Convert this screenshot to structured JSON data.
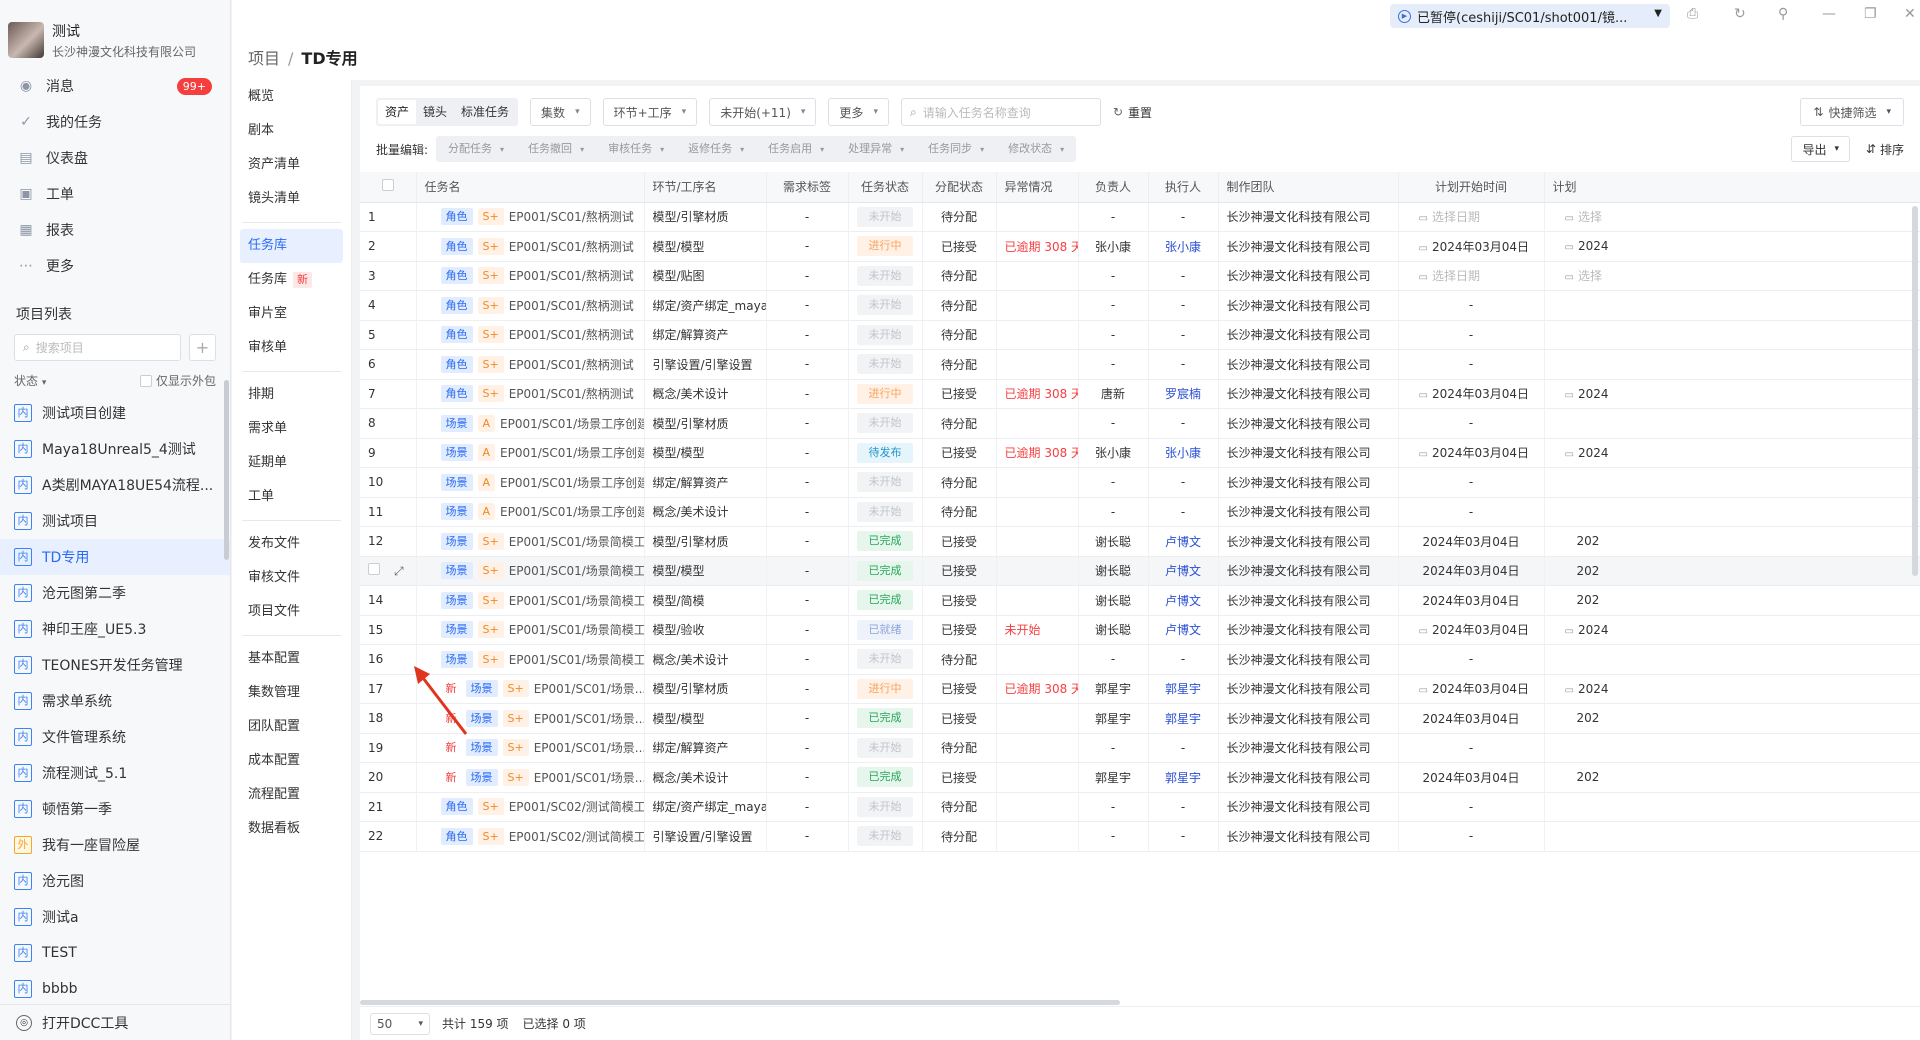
{
  "user": {
    "name": "测试",
    "company": "长沙神漫文化科技有限公司"
  },
  "nav": [
    {
      "label": "消息",
      "icon": "message-icon",
      "badge": "99+"
    },
    {
      "label": "我的任务",
      "icon": "check-icon"
    },
    {
      "label": "仪表盘",
      "icon": "dashboard-icon"
    },
    {
      "label": "工单",
      "icon": "ticket-icon"
    },
    {
      "label": "报表",
      "icon": "report-icon"
    },
    {
      "label": "更多",
      "icon": "more-icon"
    }
  ],
  "projects_section": {
    "title": "项目列表",
    "search_placeholder": "搜索项目",
    "add": "+",
    "status_label": "状态",
    "outsource_only": "仅显示外包"
  },
  "projects": [
    {
      "tag": "内",
      "name": "测试项目创建"
    },
    {
      "tag": "内",
      "name": "Maya18Unreal5_4测试"
    },
    {
      "tag": "内",
      "name": "A类剧MAYA18UE54流程..."
    },
    {
      "tag": "内",
      "name": "测试项目"
    },
    {
      "tag": "内",
      "name": "TD专用"
    },
    {
      "tag": "内",
      "name": "沧元图第二季"
    },
    {
      "tag": "内",
      "name": "神印王座_UE5.3"
    },
    {
      "tag": "内",
      "name": "TEONES开发任务管理"
    },
    {
      "tag": "内",
      "name": "需求单系统"
    },
    {
      "tag": "内",
      "name": "文件管理系统"
    },
    {
      "tag": "内",
      "name": "流程测试_5.1"
    },
    {
      "tag": "内",
      "name": "顿悟第一季"
    },
    {
      "tag": "外",
      "name": "我有一座冒险屋"
    },
    {
      "tag": "内",
      "name": "沧元图"
    },
    {
      "tag": "内",
      "name": "测试a"
    },
    {
      "tag": "内",
      "name": "TEST"
    },
    {
      "tag": "内",
      "name": "bbbb"
    }
  ],
  "bottom_tool": "打开DCC工具",
  "breadcrumb": {
    "parent": "项目",
    "sep": "/",
    "current": "TD专用"
  },
  "pause_pill": "已暂停(ceshiji/SC01/shot001/镜...",
  "subnav": [
    "概览",
    "剧本",
    "资产清单",
    "镜头清单",
    "任务库",
    "任务库",
    "审片室",
    "审核单",
    "排期",
    "需求单",
    "延期单",
    "工单",
    "发布文件",
    "审核文件",
    "项目文件",
    "基本配置",
    "集数管理",
    "团队配置",
    "成本配置",
    "流程配置",
    "数据看板"
  ],
  "subnav_new": "新",
  "toolbar": {
    "segments": [
      "资产",
      "镜头",
      "标准任务"
    ],
    "dropdowns": [
      "集数",
      "环节+工序",
      "未开始(+11)",
      "更多"
    ],
    "search_placeholder": "请输入任务名称查询",
    "reset": "重置",
    "quick_filter": "快捷筛选"
  },
  "batch": {
    "label": "批量编辑:",
    "actions": [
      "分配任务",
      "任务撤回",
      "审核任务",
      "返修任务",
      "任务启用",
      "处理异常",
      "任务同步",
      "修改状态"
    ],
    "export": "导出",
    "sort": "排序"
  },
  "columns": [
    "任务名",
    "环节/工序名",
    "需求标签",
    "任务状态",
    "分配状态",
    "异常情况",
    "负责人",
    "执行人",
    "制作团队",
    "计划开始时间",
    "计划"
  ],
  "rows": [
    {
      "no": "1",
      "new": "",
      "type": "角色",
      "lvl": "S+",
      "name": "EP001/SC01/熬柄测试",
      "star": false,
      "stage": "模型/引擎材质",
      "tag": "-",
      "status": "未开始",
      "st": "pend",
      "assign": "待分配",
      "abn": "",
      "owner": "-",
      "exec": "-",
      "team": "长沙神漫文化科技有限公司",
      "start": "选择日期",
      "startph": true,
      "end": "选择"
    },
    {
      "no": "2",
      "new": "",
      "type": "角色",
      "lvl": "S+",
      "name": "EP001/SC01/熬柄测试",
      "star": false,
      "stage": "模型/模型",
      "tag": "-",
      "status": "进行中",
      "st": "prog",
      "assign": "已接受",
      "abn": "已逾期 308 天",
      "owner": "张小康",
      "exec": "张小康",
      "team": "长沙神漫文化科技有限公司",
      "start": "2024年03月04日",
      "startcal": true,
      "end": "2024"
    },
    {
      "no": "3",
      "new": "",
      "type": "角色",
      "lvl": "S+",
      "name": "EP001/SC01/熬柄测试",
      "star": false,
      "stage": "模型/贴图",
      "tag": "-",
      "status": "未开始",
      "st": "pend",
      "assign": "待分配",
      "abn": "",
      "owner": "-",
      "exec": "-",
      "team": "长沙神漫文化科技有限公司",
      "start": "选择日期",
      "startph": true,
      "end": "选择"
    },
    {
      "no": "4",
      "new": "",
      "type": "角色",
      "lvl": "S+",
      "name": "EP001/SC01/熬柄测试",
      "star": false,
      "stage": "绑定/资产绑定_maya",
      "tag": "-",
      "status": "未开始",
      "st": "pend",
      "assign": "待分配",
      "abn": "",
      "owner": "-",
      "exec": "-",
      "team": "长沙神漫文化科技有限公司",
      "start": "-",
      "end": ""
    },
    {
      "no": "5",
      "new": "",
      "type": "角色",
      "lvl": "S+",
      "name": "EP001/SC01/熬柄测试",
      "star": false,
      "stage": "绑定/解算资产",
      "tag": "-",
      "status": "未开始",
      "st": "pend",
      "assign": "待分配",
      "abn": "",
      "owner": "-",
      "exec": "-",
      "team": "长沙神漫文化科技有限公司",
      "start": "-",
      "end": ""
    },
    {
      "no": "6",
      "new": "",
      "type": "角色",
      "lvl": "S+",
      "name": "EP001/SC01/熬柄测试",
      "star": false,
      "stage": "引擎设置/引擎设置",
      "tag": "-",
      "status": "未开始",
      "st": "pend",
      "assign": "待分配",
      "abn": "",
      "owner": "-",
      "exec": "-",
      "team": "长沙神漫文化科技有限公司",
      "start": "-",
      "end": ""
    },
    {
      "no": "7",
      "new": "",
      "type": "角色",
      "lvl": "S+",
      "name": "EP001/SC01/熬柄测试",
      "star": false,
      "stage": "概念/美术设计",
      "tag": "-",
      "status": "进行中",
      "st": "prog",
      "assign": "已接受",
      "abn": "已逾期 308 天",
      "owner": "唐新",
      "exec": "罗宸楠",
      "team": "长沙神漫文化科技有限公司",
      "start": "2024年03月04日",
      "startcal": true,
      "end": "2024"
    },
    {
      "no": "8",
      "new": "",
      "type": "场景",
      "lvl": "A",
      "name": "EP001/SC01/场景工序创建...",
      "star": false,
      "stage": "模型/引擎材质",
      "tag": "-",
      "status": "未开始",
      "st": "pend",
      "assign": "待分配",
      "abn": "",
      "owner": "-",
      "exec": "-",
      "team": "长沙神漫文化科技有限公司",
      "start": "-",
      "end": ""
    },
    {
      "no": "9",
      "new": "",
      "type": "场景",
      "lvl": "A",
      "name": "EP001/SC01/场景工序创建...",
      "star": false,
      "stage": "模型/模型",
      "tag": "-",
      "status": "待发布",
      "st": "pub",
      "assign": "已接受",
      "abn": "已逾期 308 天",
      "owner": "张小康",
      "exec": "张小康",
      "team": "长沙神漫文化科技有限公司",
      "start": "2024年03月04日",
      "startcal": true,
      "end": "2024"
    },
    {
      "no": "10",
      "new": "",
      "type": "场景",
      "lvl": "A",
      "name": "EP001/SC01/场景工序创建...",
      "star": false,
      "stage": "绑定/解算资产",
      "tag": "-",
      "status": "未开始",
      "st": "pend",
      "assign": "待分配",
      "abn": "",
      "owner": "-",
      "exec": "-",
      "team": "长沙神漫文化科技有限公司",
      "start": "-",
      "end": ""
    },
    {
      "no": "11",
      "new": "",
      "type": "场景",
      "lvl": "A",
      "name": "EP001/SC01/场景工序创建...",
      "star": false,
      "stage": "概念/美术设计",
      "tag": "-",
      "status": "未开始",
      "st": "pend",
      "assign": "待分配",
      "abn": "",
      "owner": "-",
      "exec": "-",
      "team": "长沙神漫文化科技有限公司",
      "start": "-",
      "end": ""
    },
    {
      "no": "12",
      "new": "",
      "type": "场景",
      "lvl": "S+",
      "name": "EP001/SC01/场景简模工序...",
      "star": false,
      "stage": "模型/引擎材质",
      "tag": "-",
      "status": "已完成",
      "st": "done",
      "assign": "已接受",
      "abn": "",
      "owner": "谢长聪",
      "exec": "卢博文",
      "team": "长沙神漫文化科技有限公司",
      "start": "2024年03月04日",
      "end": "202"
    },
    {
      "no": "",
      "hover": true,
      "new": "",
      "type": "场景",
      "lvl": "S+",
      "name": "EP001/SC01/场景简模工序...",
      "star": false,
      "stage": "模型/模型",
      "tag": "-",
      "status": "已完成",
      "st": "done",
      "assign": "已接受",
      "abn": "",
      "owner": "谢长聪",
      "exec": "卢博文",
      "team": "长沙神漫文化科技有限公司",
      "start": "2024年03月04日",
      "end": "202"
    },
    {
      "no": "14",
      "new": "",
      "type": "场景",
      "lvl": "S+",
      "name": "EP001/SC01/场景简模工序...",
      "star": false,
      "stage": "模型/简模",
      "tag": "-",
      "status": "已完成",
      "st": "done",
      "assign": "已接受",
      "abn": "",
      "owner": "谢长聪",
      "exec": "卢博文",
      "team": "长沙神漫文化科技有限公司",
      "start": "2024年03月04日",
      "end": "202"
    },
    {
      "no": "15",
      "new": "",
      "type": "场景",
      "lvl": "S+",
      "name": "EP001/SC01/场景简模工序...",
      "star": false,
      "stage": "模型/验收",
      "tag": "-",
      "status": "已就绪",
      "st": "ready",
      "assign": "已接受",
      "abn": "未开始",
      "owner": "谢长聪",
      "exec": "卢博文",
      "team": "长沙神漫文化科技有限公司",
      "start": "2024年03月04日",
      "startcal": true,
      "end": "2024"
    },
    {
      "no": "16",
      "new": "",
      "type": "场景",
      "lvl": "S+",
      "name": "EP001/SC01/场景简模工序...",
      "star": false,
      "stage": "概念/美术设计",
      "tag": "-",
      "status": "未开始",
      "st": "pend",
      "assign": "待分配",
      "abn": "",
      "owner": "-",
      "exec": "-",
      "team": "长沙神漫文化科技有限公司",
      "start": "-",
      "end": ""
    },
    {
      "no": "17",
      "new": "新",
      "type": "场景",
      "lvl": "S+",
      "name": "EP001/SC01/场景...",
      "star": true,
      "stage": "模型/引擎材质",
      "tag": "-",
      "status": "进行中",
      "st": "prog",
      "assign": "已接受",
      "abn": "已逾期 308 天",
      "owner": "郭星宇",
      "exec": "郭星宇",
      "team": "长沙神漫文化科技有限公司",
      "start": "2024年03月04日",
      "startcal": true,
      "end": "2024"
    },
    {
      "no": "18",
      "new": "新",
      "type": "场景",
      "lvl": "S+",
      "name": "EP001/SC01/场景...",
      "star": true,
      "stage": "模型/模型",
      "tag": "-",
      "status": "已完成",
      "st": "done",
      "assign": "已接受",
      "abn": "",
      "owner": "郭星宇",
      "exec": "郭星宇",
      "team": "长沙神漫文化科技有限公司",
      "start": "2024年03月04日",
      "end": "202"
    },
    {
      "no": "19",
      "new": "新",
      "type": "场景",
      "lvl": "S+",
      "name": "EP001/SC01/场景...",
      "star": true,
      "stage": "绑定/解算资产",
      "tag": "-",
      "status": "未开始",
      "st": "pend",
      "assign": "待分配",
      "abn": "",
      "owner": "-",
      "exec": "-",
      "team": "长沙神漫文化科技有限公司",
      "start": "-",
      "end": ""
    },
    {
      "no": "20",
      "new": "新",
      "type": "场景",
      "lvl": "S+",
      "name": "EP001/SC01/场景...",
      "star": true,
      "stage": "概念/美术设计",
      "tag": "-",
      "status": "已完成",
      "st": "done",
      "assign": "已接受",
      "abn": "",
      "owner": "郭星宇",
      "exec": "郭星宇",
      "team": "长沙神漫文化科技有限公司",
      "start": "2024年03月04日",
      "end": "202"
    },
    {
      "no": "21",
      "new": "",
      "type": "角色",
      "lvl": "S+",
      "name": "EP001/SC02/测试简模工序A",
      "star": false,
      "stage": "绑定/资产绑定_maya",
      "tag": "-",
      "status": "未开始",
      "st": "pend",
      "assign": "待分配",
      "abn": "",
      "owner": "-",
      "exec": "-",
      "team": "长沙神漫文化科技有限公司",
      "start": "-",
      "end": ""
    },
    {
      "no": "22",
      "new": "",
      "type": "角色",
      "lvl": "S+",
      "name": "EP001/SC02/测试简模工序A",
      "star": false,
      "stage": "引擎设置/引擎设置",
      "tag": "-",
      "status": "未开始",
      "st": "pend",
      "assign": "待分配",
      "abn": "",
      "owner": "-",
      "exec": "-",
      "team": "长沙神漫文化科技有限公司",
      "start": "-",
      "end": ""
    }
  ],
  "footer": {
    "page_size": "50",
    "total": "共计 159 项",
    "selected": "已选择 0 项"
  },
  "colors": {
    "accent": "#2a6af3",
    "danger": "#f53f3f",
    "success": "#26a65b"
  }
}
